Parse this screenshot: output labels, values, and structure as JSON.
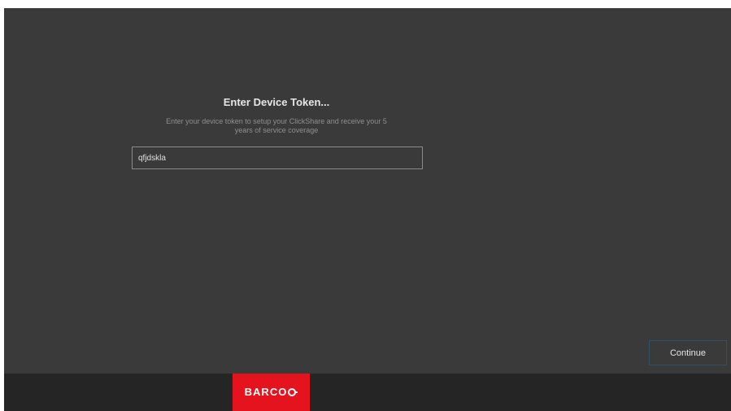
{
  "dialog": {
    "title": "Enter Device Token...",
    "subtitle_line1": "Enter your device token to setup your ClickShare and receive your 5",
    "subtitle_line2": "years of service coverage",
    "token_value": "qfjdskla"
  },
  "actions": {
    "continue_label": "Continue"
  },
  "footer": {
    "logo_text": "BARCO"
  },
  "colors": {
    "background": "#3a3a3a",
    "footer": "#252525",
    "brand_red": "#e5131d"
  }
}
